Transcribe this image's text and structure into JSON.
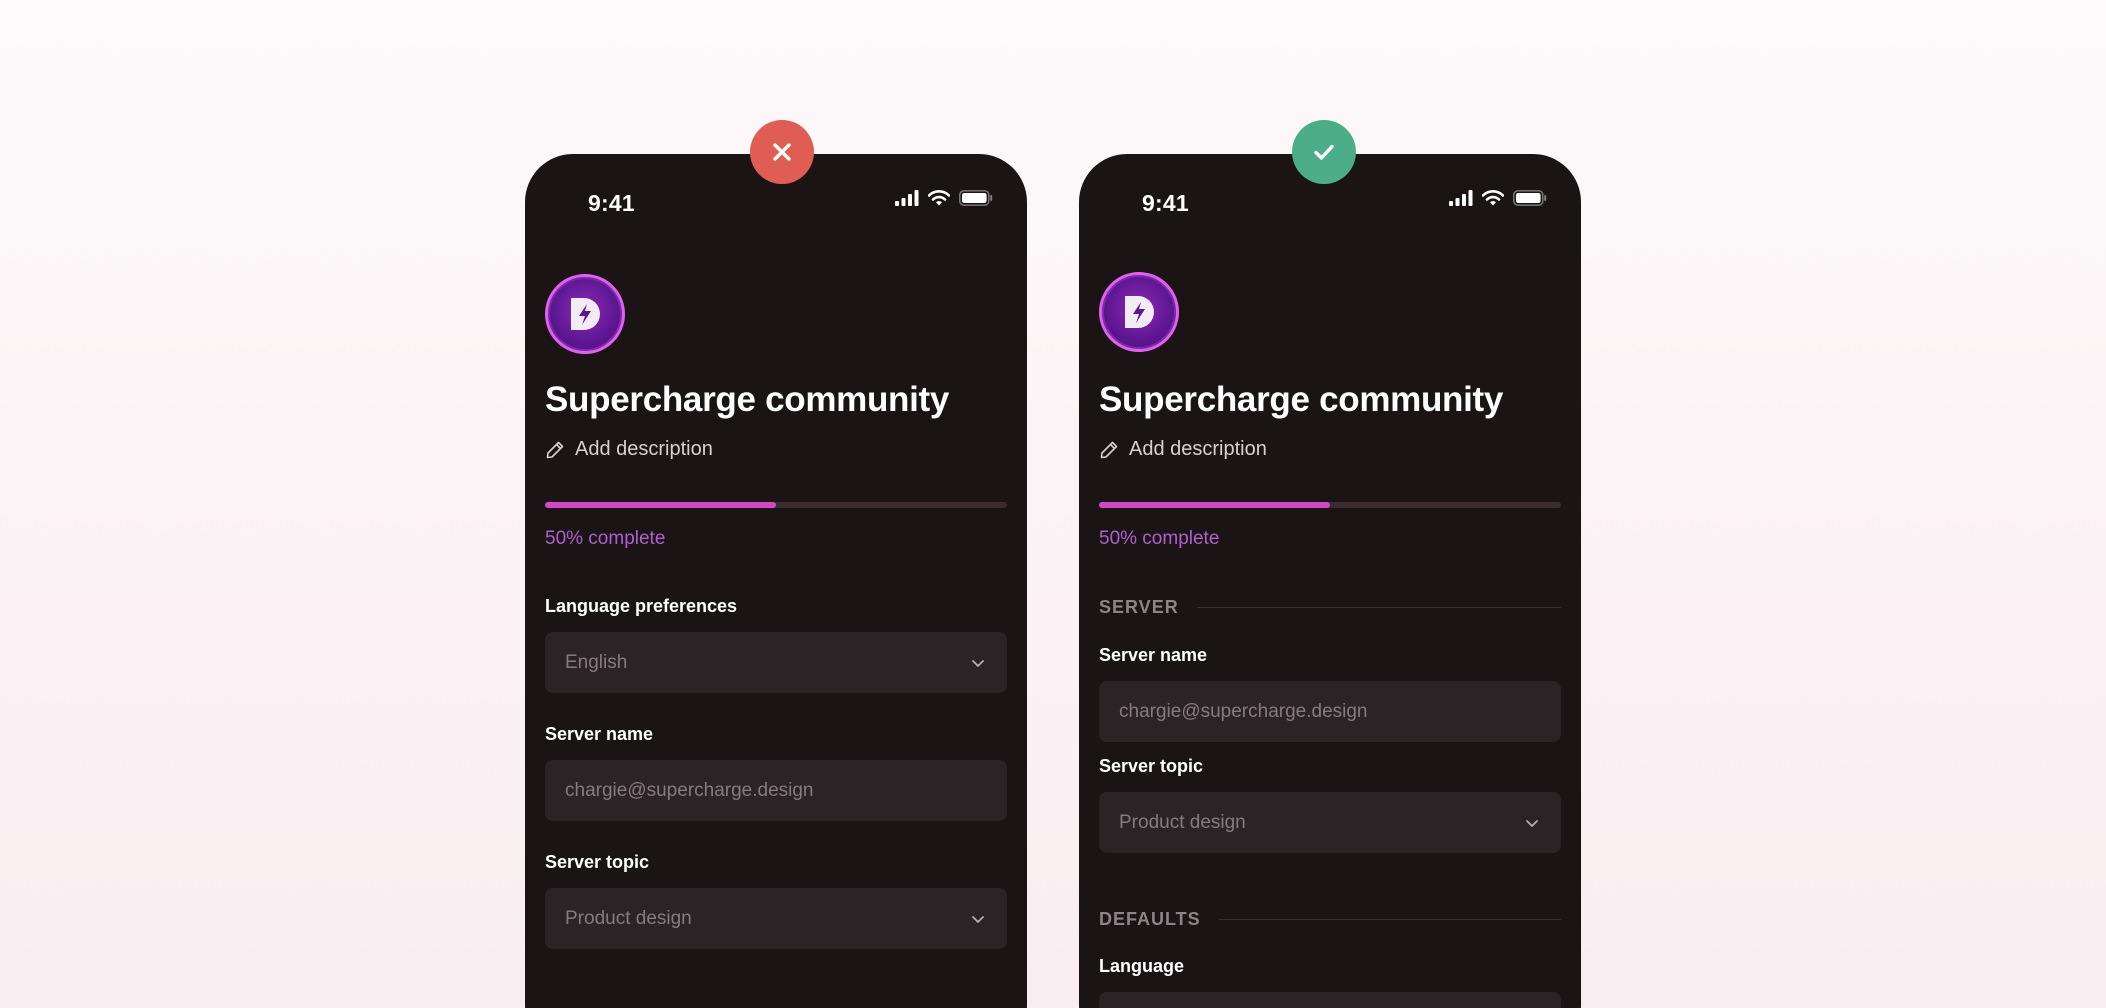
{
  "badges": {
    "bad": {
      "icon": "close-icon",
      "color": "#df5d53"
    },
    "good": {
      "icon": "check-icon",
      "color": "#4cae88"
    }
  },
  "bad_example": {
    "status_time": "9:41",
    "title": "Supercharge community",
    "add_description": "Add description",
    "progress_percent": 50,
    "progress_label": "50% complete",
    "language_label": "Language preferences",
    "language_value": "English",
    "server_name_label": "Server name",
    "server_name_placeholder": "chargie@supercharge.design",
    "server_topic_label": "Server topic",
    "server_topic_value": "Product design"
  },
  "good_example": {
    "status_time": "9:41",
    "title": "Supercharge community",
    "add_description": "Add description",
    "progress_percent": 50,
    "progress_label": "50% complete",
    "section_server": "SERVER",
    "server_name_label": "Server name",
    "server_name_placeholder": "chargie@supercharge.design",
    "server_topic_label": "Server topic",
    "server_topic_value": "Product design",
    "section_defaults": "DEFAULTS",
    "language_label": "Language"
  },
  "colors": {
    "accent": "#d546c9",
    "progress_text": "#b05ed0",
    "phone_bg": "#1b1415",
    "field_bg": "#2b2426"
  }
}
